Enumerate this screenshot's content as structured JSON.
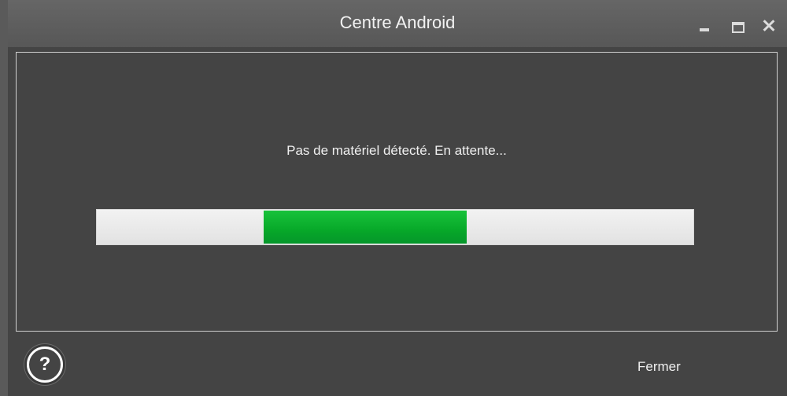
{
  "window": {
    "title": "Centre Android"
  },
  "titlebar_buttons": {
    "minimize": "minimize-icon",
    "maximize": "maximize-icon",
    "close": "close-icon"
  },
  "main": {
    "status_text": "Pas de matériel détecté. En attente...",
    "progress": {
      "fill_start_fraction": 0.28,
      "fill_end_fraction": 0.62,
      "fill_color": "#07a829",
      "track_color": "#e8e8e8"
    }
  },
  "footer": {
    "help_label": "?",
    "close_label": "Fermer"
  }
}
